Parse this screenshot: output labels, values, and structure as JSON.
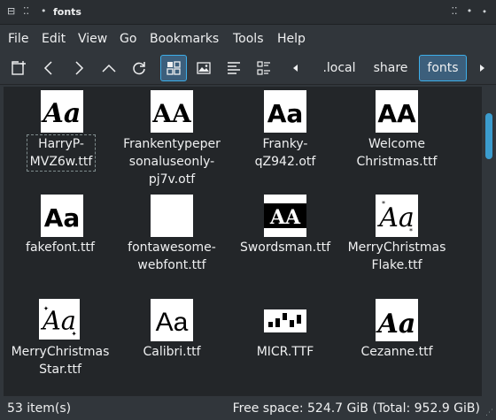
{
  "window": {
    "title": "fonts"
  },
  "menu": [
    "File",
    "Edit",
    "View",
    "Go",
    "Bookmarks",
    "Tools",
    "Help"
  ],
  "breadcrumb": [
    ".local",
    "share",
    "fonts"
  ],
  "files": [
    {
      "name_lines": [
        "HarryP-",
        "MVZ6w.ttf"
      ],
      "glyph": "Aa",
      "focused": true
    },
    {
      "name_lines": [
        "Frankentypeper",
        "sonaluseonly-",
        "pj7v.otf"
      ],
      "glyph": "AA"
    },
    {
      "name_lines": [
        "Franky-",
        "qZ942.otf"
      ],
      "glyph": "Aa"
    },
    {
      "name_lines": [
        "Welcome",
        "Christmas.ttf"
      ],
      "glyph": "AA"
    },
    {
      "name_lines": [
        "fakefont.ttf"
      ],
      "glyph": "Aa"
    },
    {
      "name_lines": [
        "fontawesome-",
        "webfont.ttf"
      ],
      "glyph": ""
    },
    {
      "name_lines": [
        "Swordsman.ttf"
      ],
      "glyph": "AA"
    },
    {
      "name_lines": [
        "MerryChristmas",
        "Flake.ttf"
      ],
      "glyph": "Aa"
    },
    {
      "name_lines": [
        "MerryChristmas",
        "Star.ttf"
      ],
      "glyph": "Aa"
    },
    {
      "name_lines": [
        "Calibri.ttf"
      ],
      "glyph": "Aa"
    },
    {
      "name_lines": [
        "MICR.TTF"
      ],
      "glyph": ""
    },
    {
      "name_lines": [
        "Cezanne.ttf"
      ],
      "glyph": "Aa"
    }
  ],
  "status": {
    "items": "53 item(s)",
    "space": "Free space: 524.7 GiB (Total: 952.9 GiB)"
  },
  "colors": {
    "accent": "#3daee9",
    "background": "#31363b",
    "view": "#232629"
  }
}
